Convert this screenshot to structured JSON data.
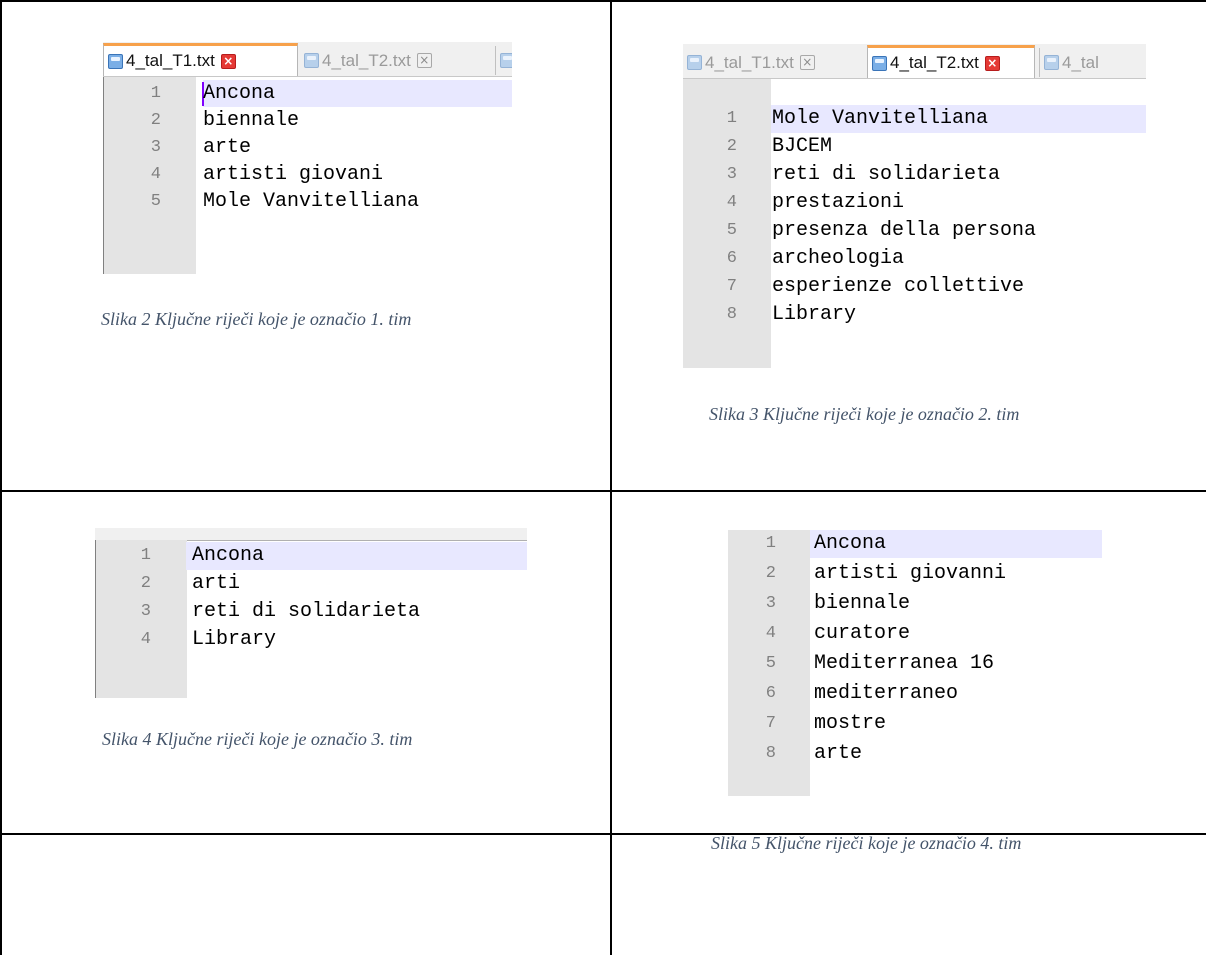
{
  "figures": [
    {
      "tabs": [
        {
          "label": "4_tal_T1.txt",
          "active": true
        },
        {
          "label": "4_tal_T2.txt",
          "active": false
        },
        {
          "label": "",
          "active": false
        }
      ],
      "lines": [
        "Ancona",
        "biennale",
        "arte",
        "artisti giovani",
        "Mole Vanvitelliana"
      ],
      "caption": "Slika 2 Ključne riječi koje je označio 1. tim"
    },
    {
      "tabs": [
        {
          "label": "4_tal_T1.txt",
          "active": false
        },
        {
          "label": "4_tal_T2.txt",
          "active": true
        },
        {
          "label": "4_tal",
          "active": false
        }
      ],
      "lines": [
        "Mole Vanvitelliana",
        "BJCEM",
        "reti di solidarieta",
        "prestazioni",
        "presenza della persona",
        "archeologia",
        "esperienze collettive",
        "Library"
      ],
      "caption": "Slika 3 Ključne riječi koje je označio 2. tim"
    },
    {
      "tabs": [],
      "lines": [
        "Ancona",
        "arti",
        "reti di solidarieta",
        "Library"
      ],
      "caption": "Slika 4 Ključne riječi koje je označio 3. tim"
    },
    {
      "tabs": [],
      "lines": [
        "Ancona",
        "artisti giovanni",
        "biennale",
        "curatore",
        "Mediterranea 16",
        "mediterraneo",
        "mostre",
        "arte"
      ],
      "caption": "Slika 5 Ključne riječi koje je označio 4. tim"
    }
  ],
  "line_numbers": [
    "1",
    "2",
    "3",
    "4",
    "5",
    "6",
    "7",
    "8"
  ],
  "colors": {
    "gutter": "#e4e4e4",
    "current_line_highlight": "#e8e8ff",
    "active_tab_accent": "#f7a14b",
    "caption_text": "#44546a",
    "close_active": "#e53935"
  }
}
